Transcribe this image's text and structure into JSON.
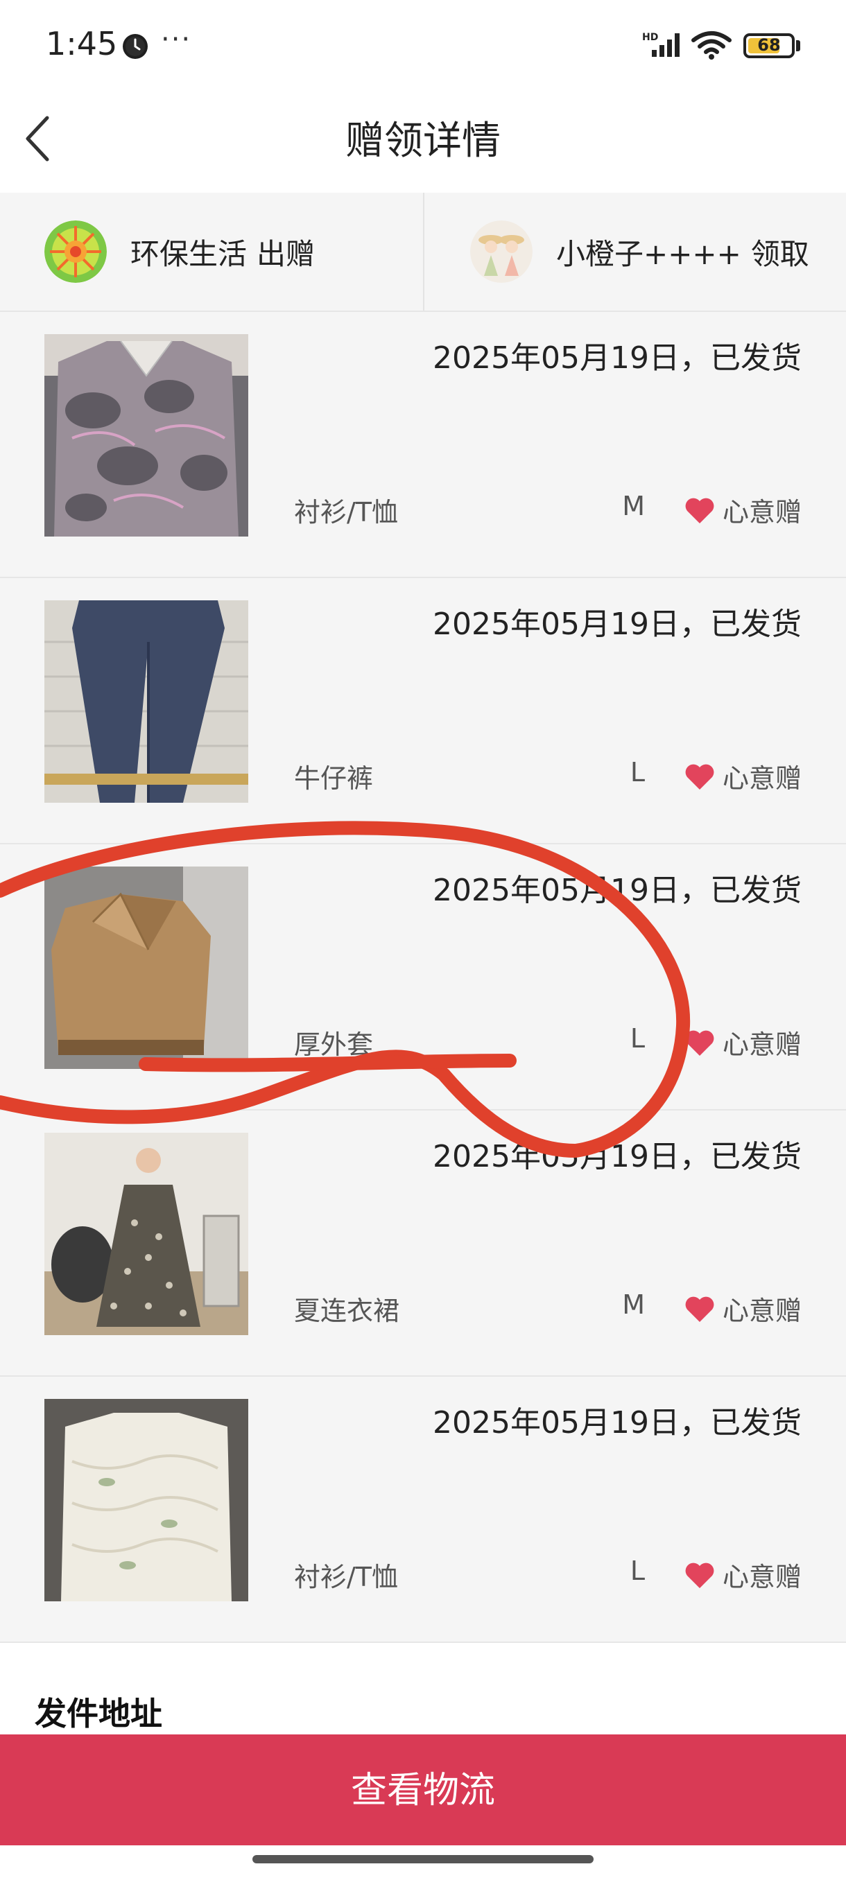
{
  "status_bar": {
    "time": "1:45",
    "more": "···",
    "network": "HD",
    "battery": "68"
  },
  "header": {
    "title": "赠领详情"
  },
  "donor": {
    "name": "环保生活",
    "action": "出赠"
  },
  "receiver": {
    "name": "小橙子++++",
    "action": "领取"
  },
  "items": [
    {
      "date": "2025年05月19日，已发货",
      "category": "衬衫/T恤",
      "size": "M",
      "gift": "心意赠",
      "photo": "gray-floral-shirt"
    },
    {
      "date": "2025年05月19日，已发货",
      "category": "牛仔裤",
      "size": "L",
      "gift": "心意赠",
      "photo": "blue-jeans"
    },
    {
      "date": "2025年05月19日，已发货",
      "category": "厚外套",
      "size": "L",
      "gift": "心意赠",
      "photo": "tan-fleece-jacket"
    },
    {
      "date": "2025年05月19日，已发货",
      "category": "夏连衣裙",
      "size": "M",
      "gift": "心意赠",
      "photo": "floral-maxi-dress"
    },
    {
      "date": "2025年05月19日，已发货",
      "category": "衬衫/T恤",
      "size": "L",
      "gift": "心意赠",
      "photo": "white-ruffle-blouse"
    }
  ],
  "address": {
    "title": "发件地址"
  },
  "footer": {
    "button_label": "查看物流"
  },
  "colors": {
    "accent": "#d93a55",
    "heart": "#e2445c",
    "annotation": "#e0412c",
    "background": "#f5f5f5"
  }
}
